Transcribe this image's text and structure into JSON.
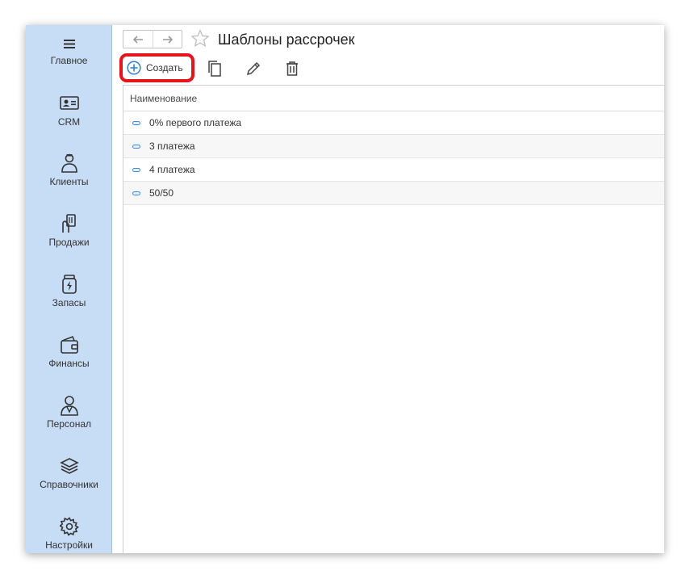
{
  "sidebar": {
    "items": [
      {
        "label": "Главное",
        "icon": "menu-icon"
      },
      {
        "label": "CRM",
        "icon": "id-card-icon"
      },
      {
        "label": "Клиенты",
        "icon": "client-icon"
      },
      {
        "label": "Продажи",
        "icon": "sales-icon"
      },
      {
        "label": "Запасы",
        "icon": "stock-icon"
      },
      {
        "label": "Финансы",
        "icon": "wallet-icon"
      },
      {
        "label": "Персонал",
        "icon": "staff-icon"
      },
      {
        "label": "Справочники",
        "icon": "layers-icon"
      },
      {
        "label": "Настройки",
        "icon": "gear-icon"
      }
    ]
  },
  "header": {
    "title": "Шаблоны рассрочек"
  },
  "toolbar": {
    "create_label": "Создать",
    "highlight_color": "#e4141b"
  },
  "table": {
    "columns": [
      "Наименование"
    ],
    "rows": [
      {
        "name": "0% первого платежа"
      },
      {
        "name": "3 платежа"
      },
      {
        "name": "4 платежа"
      },
      {
        "name": "50/50"
      }
    ]
  },
  "colors": {
    "sidebar_bg": "#c7dcf5",
    "accent": "#2f7bd2"
  }
}
